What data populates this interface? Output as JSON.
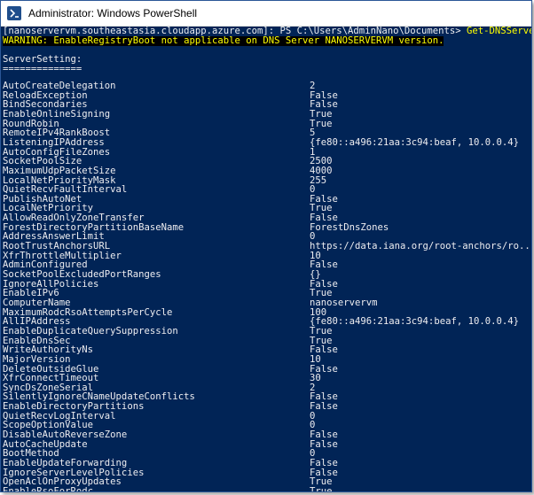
{
  "window": {
    "title": "Administrator: Windows PowerShell",
    "icon": "powershell-icon"
  },
  "console": {
    "prompt_prefix": "[nanoservervm.southeastasia.cloudapp.azure.com]: PS C:\\Users\\AdminNano\\Documents> ",
    "command": "Get-DNSServer",
    "warning": "WARNING: EnableRegistryBoot not applicable on DNS Server NANOSERVERVM version.",
    "section_header": "ServerSetting:",
    "separator": "==============",
    "settings": [
      {
        "key": "AutoCreateDelegation",
        "value": "2"
      },
      {
        "key": "ReloadException",
        "value": "False"
      },
      {
        "key": "BindSecondaries",
        "value": "False"
      },
      {
        "key": "EnableOnlineSigning",
        "value": "True"
      },
      {
        "key": "RoundRobin",
        "value": "True"
      },
      {
        "key": "RemoteIPv4RankBoost",
        "value": "5"
      },
      {
        "key": "ListeningIPAddress",
        "value": "{fe80::a496:21aa:3c94:beaf, 10.0.0.4}"
      },
      {
        "key": "AutoConfigFileZones",
        "value": "1"
      },
      {
        "key": "SocketPoolSize",
        "value": "2500"
      },
      {
        "key": "MaximumUdpPacketSize",
        "value": "4000"
      },
      {
        "key": "LocalNetPriorityMask",
        "value": "255"
      },
      {
        "key": "QuietRecvFaultInterval",
        "value": "0"
      },
      {
        "key": "PublishAutoNet",
        "value": "False"
      },
      {
        "key": "LocalNetPriority",
        "value": "True"
      },
      {
        "key": "AllowReadOnlyZoneTransfer",
        "value": "False"
      },
      {
        "key": "ForestDirectoryPartitionBaseName",
        "value": "ForestDnsZones"
      },
      {
        "key": "AddressAnswerLimit",
        "value": "0"
      },
      {
        "key": "RootTrustAnchorsURL",
        "value": "https://data.iana.org/root-anchors/ro..."
      },
      {
        "key": "XfrThrottleMultiplier",
        "value": "10"
      },
      {
        "key": "AdminConfigured",
        "value": "False"
      },
      {
        "key": "SocketPoolExcludedPortRanges",
        "value": "{}"
      },
      {
        "key": "IgnoreAllPolicies",
        "value": "False"
      },
      {
        "key": "EnableIPv6",
        "value": "True"
      },
      {
        "key": "ComputerName",
        "value": "nanoservervm"
      },
      {
        "key": "MaximumRodcRsoAttemptsPerCycle",
        "value": "100"
      },
      {
        "key": "AllIPAddress",
        "value": "{fe80::a496:21aa:3c94:beaf, 10.0.0.4}"
      },
      {
        "key": "EnableDuplicateQuerySuppression",
        "value": "True"
      },
      {
        "key": "EnableDnsSec",
        "value": "True"
      },
      {
        "key": "WriteAuthorityNs",
        "value": "False"
      },
      {
        "key": "MajorVersion",
        "value": "10"
      },
      {
        "key": "DeleteOutsideGlue",
        "value": "False"
      },
      {
        "key": "XfrConnectTimeout",
        "value": "30"
      },
      {
        "key": "SyncDsZoneSerial",
        "value": "2"
      },
      {
        "key": "SilentlyIgnoreCNameUpdateConflicts",
        "value": "False"
      },
      {
        "key": "EnableDirectoryPartitions",
        "value": "False"
      },
      {
        "key": "QuietRecvLogInterval",
        "value": "0"
      },
      {
        "key": "ScopeOptionValue",
        "value": "0"
      },
      {
        "key": "DisableAutoReverseZone",
        "value": "False"
      },
      {
        "key": "AutoCacheUpdate",
        "value": "False"
      },
      {
        "key": "BootMethod",
        "value": "0"
      },
      {
        "key": "EnableUpdateForwarding",
        "value": "False"
      },
      {
        "key": "IgnoreServerLevelPolicies",
        "value": "False"
      },
      {
        "key": "OpenAclOnProxyUpdates",
        "value": "True"
      },
      {
        "key": "EnableRsoForRodc",
        "value": "True"
      }
    ]
  },
  "colors": {
    "console_bg": "#012456",
    "console_text": "#eeedf0",
    "warning_text": "#ffff00",
    "warning_bg": "#000000",
    "command_text": "#ffff00"
  }
}
